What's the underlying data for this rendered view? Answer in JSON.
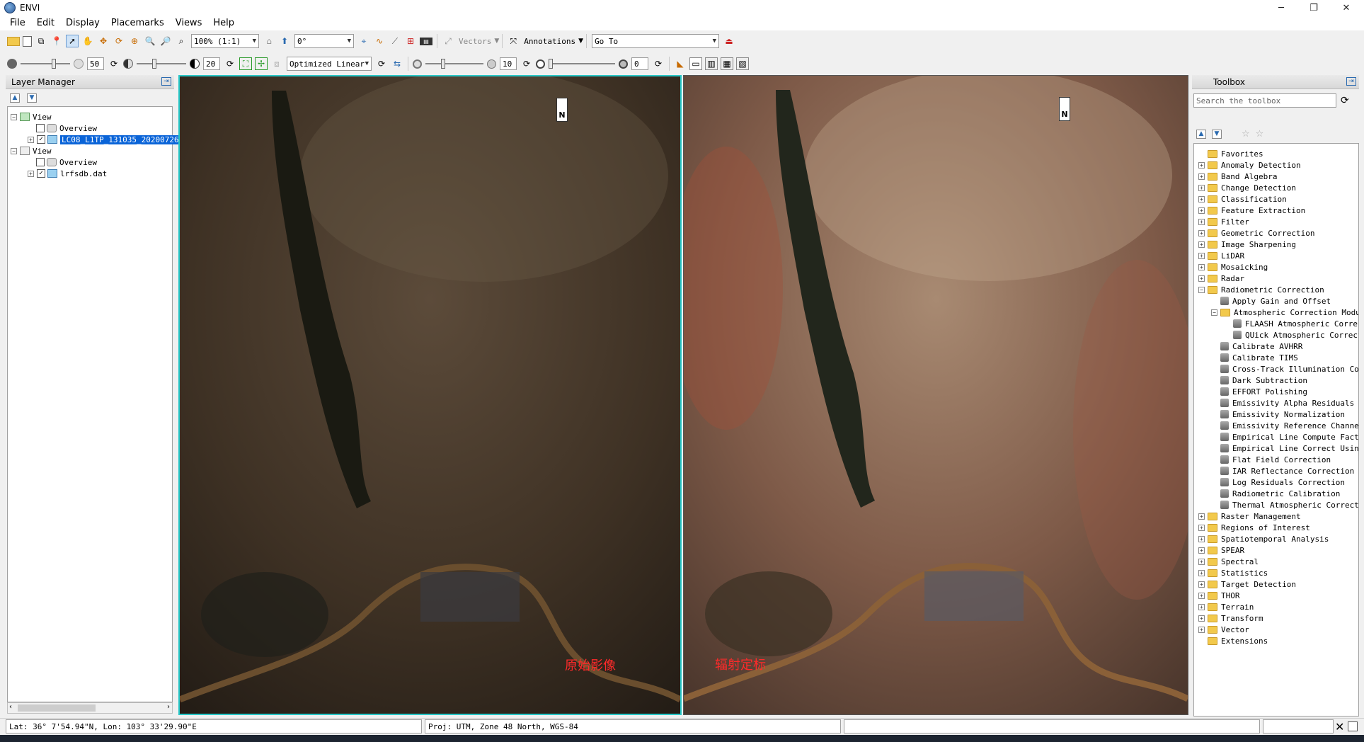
{
  "window": {
    "title": "ENVI",
    "minimize": "─",
    "maximize": "❐",
    "close": "✕"
  },
  "menu": [
    "File",
    "Edit",
    "Display",
    "Placemarks",
    "Views",
    "Help"
  ],
  "toolbar1": {
    "zoom_value": "100% (1:1)",
    "rotation_value": "0°",
    "vectors_label": "Vectors",
    "annotations_label": "Annotations",
    "goto_value": "Go To"
  },
  "toolbar2": {
    "brightness_value": "50",
    "contrast_value": "20",
    "stretch_value": "Optimized Linear",
    "sharpen_value": "10",
    "transparency_value": "0"
  },
  "layer_manager": {
    "title": "Layer Manager",
    "tree": [
      {
        "label": "View"
      },
      {
        "label": "Overview",
        "checked": false
      },
      {
        "label": "LC08_L1TP_131035_20200726",
        "checked": true,
        "selected": true
      },
      {
        "label": "View"
      },
      {
        "label": "Overview",
        "checked": false
      },
      {
        "label": "lrfsdb.dat",
        "checked": true
      }
    ]
  },
  "views": {
    "left": {
      "caption": "原始影像",
      "north_label": "N"
    },
    "right": {
      "caption": "辐射定标",
      "north_label": "N"
    }
  },
  "toolbox": {
    "title": "Toolbox",
    "search_placeholder": "Search the toolbox",
    "items": [
      {
        "label": "Favorites",
        "level": 0,
        "kind": "folder",
        "expander": ""
      },
      {
        "label": "Anomaly Detection",
        "level": 0,
        "kind": "folder",
        "expander": "+"
      },
      {
        "label": "Band Algebra",
        "level": 0,
        "kind": "folder",
        "expander": "+"
      },
      {
        "label": "Change Detection",
        "level": 0,
        "kind": "folder",
        "expander": "+"
      },
      {
        "label": "Classification",
        "level": 0,
        "kind": "folder",
        "expander": "+"
      },
      {
        "label": "Feature Extraction",
        "level": 0,
        "kind": "folder",
        "expander": "+"
      },
      {
        "label": "Filter",
        "level": 0,
        "kind": "folder",
        "expander": "+"
      },
      {
        "label": "Geometric Correction",
        "level": 0,
        "kind": "folder",
        "expander": "+"
      },
      {
        "label": "Image Sharpening",
        "level": 0,
        "kind": "folder",
        "expander": "+"
      },
      {
        "label": "LiDAR",
        "level": 0,
        "kind": "folder",
        "expander": "+"
      },
      {
        "label": "Mosaicking",
        "level": 0,
        "kind": "folder",
        "expander": "+"
      },
      {
        "label": "Radar",
        "level": 0,
        "kind": "folder",
        "expander": "+"
      },
      {
        "label": "Radiometric Correction",
        "level": 0,
        "kind": "folder",
        "expander": "−"
      },
      {
        "label": "Apply Gain and Offset",
        "level": 1,
        "kind": "tool",
        "expander": ""
      },
      {
        "label": "Atmospheric Correction Modul",
        "level": 1,
        "kind": "folder",
        "expander": "−"
      },
      {
        "label": "FLAASH Atmospheric Correc",
        "level": 2,
        "kind": "tool",
        "expander": ""
      },
      {
        "label": "QUick Atmospheric Correct",
        "level": 2,
        "kind": "tool",
        "expander": ""
      },
      {
        "label": "Calibrate AVHRR",
        "level": 1,
        "kind": "tool",
        "expander": ""
      },
      {
        "label": "Calibrate TIMS",
        "level": 1,
        "kind": "tool",
        "expander": ""
      },
      {
        "label": "Cross-Track Illumination Cor",
        "level": 1,
        "kind": "tool",
        "expander": ""
      },
      {
        "label": "Dark Subtraction",
        "level": 1,
        "kind": "tool",
        "expander": ""
      },
      {
        "label": "EFFORT Polishing",
        "level": 1,
        "kind": "tool",
        "expander": ""
      },
      {
        "label": "Emissivity Alpha Residuals",
        "level": 1,
        "kind": "tool",
        "expander": ""
      },
      {
        "label": "Emissivity Normalization",
        "level": 1,
        "kind": "tool",
        "expander": ""
      },
      {
        "label": "Emissivity Reference Channel",
        "level": 1,
        "kind": "tool",
        "expander": ""
      },
      {
        "label": "Empirical Line Compute Facto",
        "level": 1,
        "kind": "tool",
        "expander": ""
      },
      {
        "label": "Empirical Line Correct Using",
        "level": 1,
        "kind": "tool",
        "expander": ""
      },
      {
        "label": "Flat Field Correction",
        "level": 1,
        "kind": "tool",
        "expander": ""
      },
      {
        "label": "IAR Reflectance Correction",
        "level": 1,
        "kind": "tool",
        "expander": ""
      },
      {
        "label": "Log Residuals Correction",
        "level": 1,
        "kind": "tool",
        "expander": ""
      },
      {
        "label": "Radiometric Calibration",
        "level": 1,
        "kind": "tool",
        "expander": ""
      },
      {
        "label": "Thermal Atmospheric Correcti",
        "level": 1,
        "kind": "tool",
        "expander": ""
      },
      {
        "label": "Raster Management",
        "level": 0,
        "kind": "folder",
        "expander": "+"
      },
      {
        "label": "Regions of Interest",
        "level": 0,
        "kind": "folder",
        "expander": "+"
      },
      {
        "label": "Spatiotemporal Analysis",
        "level": 0,
        "kind": "folder",
        "expander": "+"
      },
      {
        "label": "SPEAR",
        "level": 0,
        "kind": "folder",
        "expander": "+"
      },
      {
        "label": "Spectral",
        "level": 0,
        "kind": "folder",
        "expander": "+"
      },
      {
        "label": "Statistics",
        "level": 0,
        "kind": "folder",
        "expander": "+"
      },
      {
        "label": "Target Detection",
        "level": 0,
        "kind": "folder",
        "expander": "+"
      },
      {
        "label": "THOR",
        "level": 0,
        "kind": "folder",
        "expander": "+"
      },
      {
        "label": "Terrain",
        "level": 0,
        "kind": "folder",
        "expander": "+"
      },
      {
        "label": "Transform",
        "level": 0,
        "kind": "folder",
        "expander": "+"
      },
      {
        "label": "Vector",
        "level": 0,
        "kind": "folder",
        "expander": "+"
      },
      {
        "label": "Extensions",
        "level": 0,
        "kind": "folder",
        "expander": ""
      }
    ]
  },
  "status": {
    "latlon": "Lat: 36° 7'54.94\"N, Lon: 103° 33'29.90\"E",
    "projection": "Proj: UTM, Zone 48 North, WGS-84"
  },
  "colors": {
    "selection": "#0a64d8",
    "active_view_border": "#28c8c8",
    "caption": "#ff2a2a"
  }
}
